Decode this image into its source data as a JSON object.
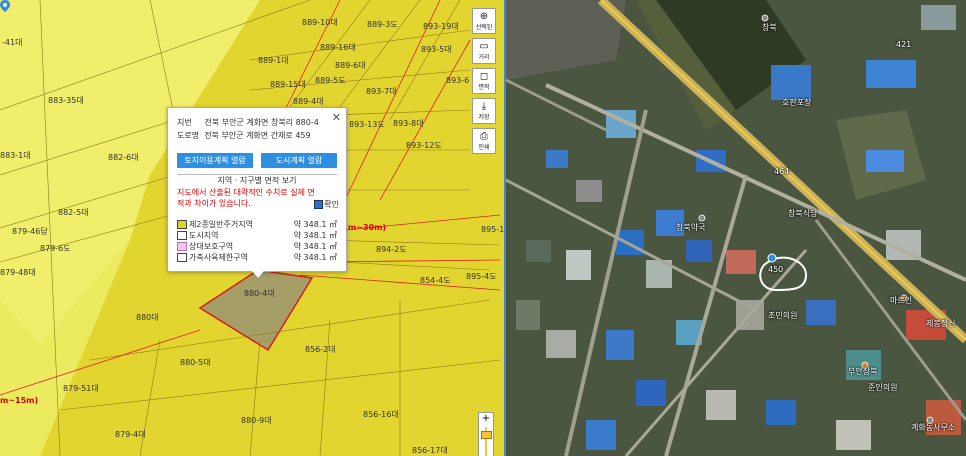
{
  "left_parcels": [
    {
      "id": "l1",
      "text": "889-10대"
    },
    {
      "id": "l2",
      "text": "889-3도"
    },
    {
      "id": "l3",
      "text": "893-19대"
    },
    {
      "id": "l4",
      "text": "-41대"
    },
    {
      "id": "l5",
      "text": "889-16대"
    },
    {
      "id": "l6",
      "text": "893-5대"
    },
    {
      "id": "l7",
      "text": "889-1대"
    },
    {
      "id": "l8",
      "text": "889-6대"
    },
    {
      "id": "l9",
      "text": "889-15대"
    },
    {
      "id": "l10",
      "text": "889-5도"
    },
    {
      "id": "l11",
      "text": "893-7대"
    },
    {
      "id": "l12",
      "text": "893-6"
    },
    {
      "id": "l13",
      "text": "883-35대"
    },
    {
      "id": "l14",
      "text": "889-4대"
    },
    {
      "id": "l15",
      "text": "893-13도"
    },
    {
      "id": "l16",
      "text": "893-8대"
    },
    {
      "id": "l17",
      "text": "893-12도"
    },
    {
      "id": "l18",
      "text": "883-1대"
    },
    {
      "id": "l19",
      "text": "882-6대"
    },
    {
      "id": "l20",
      "text": "882-5대"
    },
    {
      "id": "l21",
      "text": "895-1"
    },
    {
      "id": "l22",
      "text": "879-46답"
    },
    {
      "id": "l23",
      "text": "879-6도"
    },
    {
      "id": "l24",
      "text": "894-2도"
    },
    {
      "id": "l25",
      "text": "879-48대"
    },
    {
      "id": "l26",
      "text": "854-4도"
    },
    {
      "id": "l27",
      "text": "895-4도"
    },
    {
      "id": "l28",
      "text": "880-4대"
    },
    {
      "id": "l29",
      "text": "880대"
    },
    {
      "id": "l30",
      "text": "856-2대"
    },
    {
      "id": "l31",
      "text": "879-51대"
    },
    {
      "id": "l32",
      "text": "880-5대"
    },
    {
      "id": "l33",
      "text": "880-9대"
    },
    {
      "id": "l34",
      "text": "856-16대"
    },
    {
      "id": "l35",
      "text": "879-4대"
    },
    {
      "id": "l36",
      "text": "856-17대"
    }
  ],
  "zone_labels": [
    {
      "id": "z1",
      "text": "m~30m)"
    },
    {
      "id": "z2",
      "text": "m~15m)"
    }
  ],
  "toolbar": [
    {
      "id": "select",
      "icon": "⊕",
      "label": "선택된"
    },
    {
      "id": "distance",
      "icon": "▭",
      "label": "거리"
    },
    {
      "id": "area",
      "icon": "◻",
      "label": "면적"
    },
    {
      "id": "save",
      "icon": "⤓",
      "label": "저장"
    },
    {
      "id": "print",
      "icon": "⎙",
      "label": "인쇄"
    }
  ],
  "popup": {
    "jibun_label": "지번",
    "jibun_value": "전북 부안군 계화면 창북리 880-4",
    "road_label": "도로명",
    "road_value": "전북 부안군 계화면 간재로 459",
    "btn_land": "토지이용계획 열람",
    "btn_city": "도시계획 열람",
    "section_title": "지역 · 지구별 면적 보기",
    "warning": "지도에서 산출된 대략적인 수치로 실제 면적과 차이가 있습니다.",
    "confirm": "확인",
    "zones": [
      {
        "name": "제2종일반주거지역",
        "area": "약 348.1 ㎡",
        "color": "#d9d42f"
      },
      {
        "name": "도시지역",
        "area": "약 348.1 ㎡",
        "color": "#ffffff"
      },
      {
        "name": "상대보호구역",
        "area": "약 348.1 ㎡",
        "color": "#f4c6e8"
      },
      {
        "name": "가축사육제한구역",
        "area": "약 348.1 ㎡",
        "color": "#ffffff"
      }
    ]
  },
  "sat_labels": [
    {
      "id": "s1",
      "text": "창북"
    },
    {
      "id": "s2",
      "text": "호판포장"
    },
    {
      "id": "s3",
      "text": "창북약국"
    },
    {
      "id": "s4",
      "text": "창북식당"
    },
    {
      "id": "s5",
      "text": "조민의원"
    },
    {
      "id": "s6",
      "text": "마르인"
    },
    {
      "id": "s7",
      "text": "제봉정신"
    },
    {
      "id": "s8",
      "text": "부안창북"
    },
    {
      "id": "s9",
      "text": "준인의원"
    },
    {
      "id": "s10",
      "text": "계화동사무소"
    },
    {
      "id": "s11",
      "text": "464"
    },
    {
      "id": "s12",
      "text": "421"
    },
    {
      "id": "s13",
      "text": "450"
    }
  ]
}
